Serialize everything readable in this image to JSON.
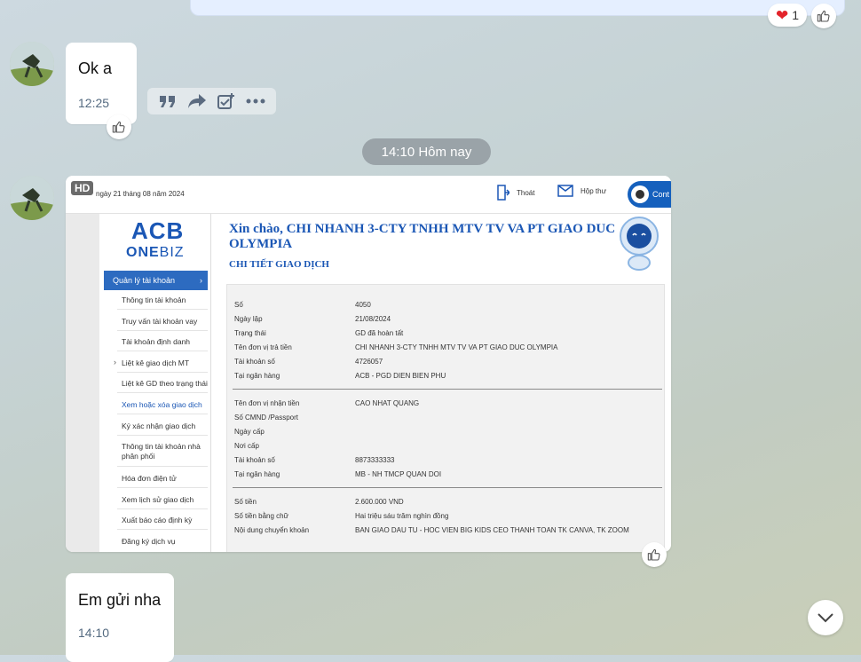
{
  "top_reaction": {
    "heart_count": "1"
  },
  "messages": [
    {
      "text": "Ok a",
      "time": "12:25"
    },
    {
      "text": "Em gửi nha",
      "time": "14:10"
    }
  ],
  "date_divider": "14:10 Hôm nay",
  "toolbar_icons": [
    "quote-icon",
    "forward-icon",
    "task-icon",
    "more-icon"
  ],
  "screenshot": {
    "hd_badge": "HD",
    "date_text": "ngày 21 tháng 08 năm 2024",
    "logout": "Thoát",
    "inbox": "Hộp thư",
    "contact": "Cont",
    "logo_main": "ACB",
    "logo_one": "ONE",
    "logo_biz": "BIZ",
    "menu_active": "Quản lý tài khoản",
    "menu_items": [
      "Thông tin tài khoản",
      "Truy vấn tài khoản vay",
      "Tài khoản định danh",
      "Liệt kê giao dịch MT",
      "Liệt kê GD theo trạng thái",
      "Xem hoặc xóa giao dịch",
      "Ký xác nhận giao dịch",
      "Thông tin tài khoản nhà phân phối",
      "Hóa đơn điện tử",
      "Xem lịch sử giao dịch",
      "Xuất báo cáo định kỳ",
      "Đăng ký dịch vụ"
    ],
    "greeting": "Xin chào, CHI NHANH 3-CTY TNHH MTV TV VA PT GIAO DUC OLYMPIA",
    "detail_title": "CHI TIẾT GIAO DỊCH",
    "rows_group1": [
      {
        "label": "Số",
        "value": "4050"
      },
      {
        "label": "Ngày lập",
        "value": "21/08/2024"
      },
      {
        "label": "Trạng thái",
        "value": "GD đã hoàn tất"
      },
      {
        "label": "Tên đơn vị trả tiền",
        "value": "CHI NHANH 3-CTY TNHH MTV TV VA PT GIAO DUC OLYMPIA"
      },
      {
        "label": "Tài khoản số",
        "value": "4726057"
      },
      {
        "label": "Tại ngân hàng",
        "value": "ACB - PGD DIEN BIEN PHU"
      }
    ],
    "rows_group2": [
      {
        "label": "Tên đơn vị nhận tiền",
        "value": "CAO NHAT QUANG"
      },
      {
        "label": "Số CMND /Passport",
        "value": ""
      },
      {
        "label": "Ngày cấp",
        "value": ""
      },
      {
        "label": "Nơi cấp",
        "value": ""
      },
      {
        "label": "Tài khoản số",
        "value": "8873333333"
      },
      {
        "label": "Tại ngân hàng",
        "value": "MB - NH TMCP QUAN DOI"
      }
    ],
    "rows_group3": [
      {
        "label": "Số tiền",
        "value": "2.600.000 VND"
      },
      {
        "label": "Số tiền bằng chữ",
        "value": "Hai triệu sáu trăm nghìn đồng"
      },
      {
        "label": "Nội dung chuyển khoản",
        "value": "BAN GIAO DAU TU - HOC VIEN BIG KIDS CEO THANH TOAN TK CANVA, TK ZOOM"
      }
    ]
  }
}
